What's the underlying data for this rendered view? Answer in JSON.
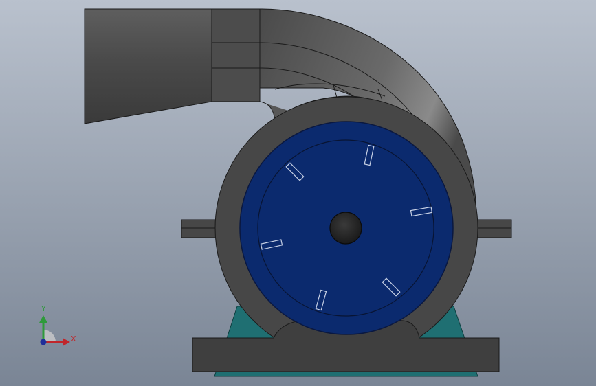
{
  "viewport": {
    "background_top": "#b9c1cd",
    "background_bottom": "#7a8595"
  },
  "model": {
    "housing_color": "#474747",
    "housing_edge": "#1a1a1a",
    "impeller_color": "#0b2a6e",
    "hub_color": "#2a2a2a",
    "base_color": "#3f3f3f",
    "pedestal_color": "#1f6f72"
  },
  "triad": {
    "x_label": "X",
    "y_label": "Y",
    "x_color": "#c0262b",
    "y_color": "#2e9a3a",
    "z_color": "#1f2f9a"
  }
}
